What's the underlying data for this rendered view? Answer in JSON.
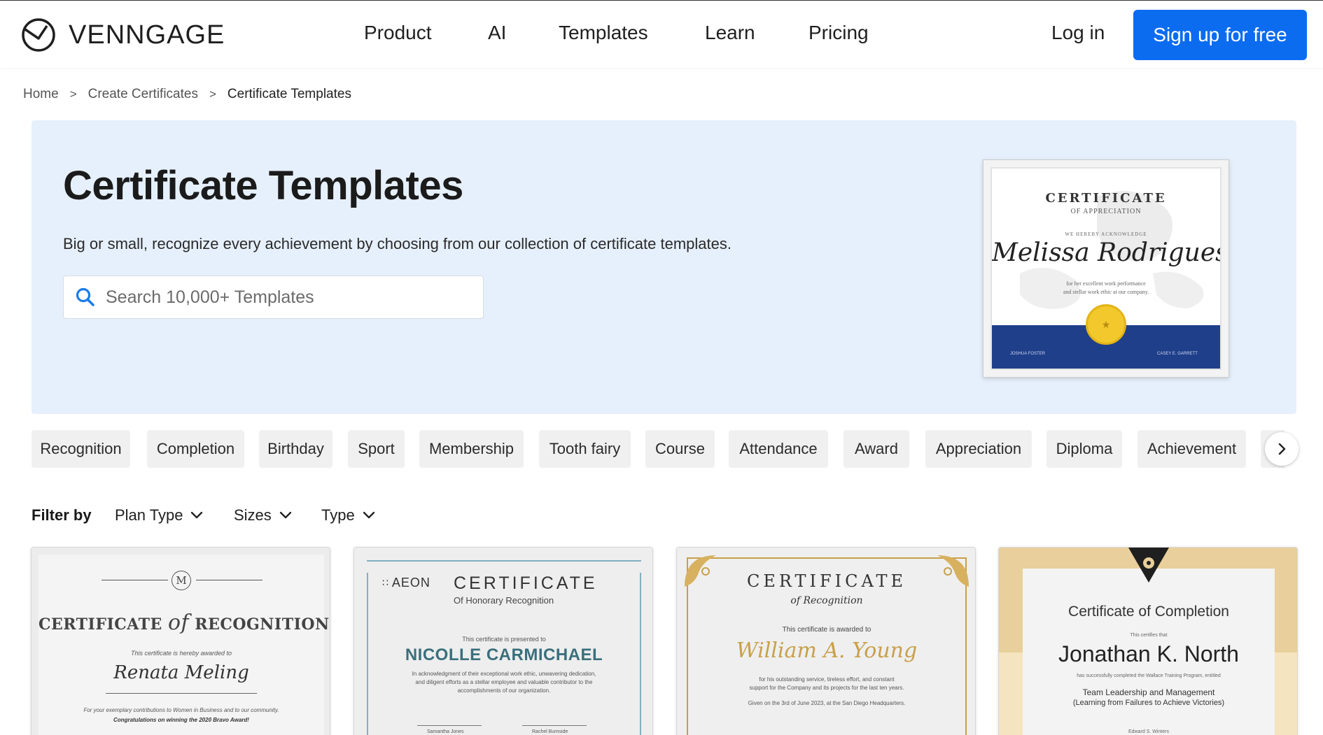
{
  "brand": {
    "name": "VENNGAGE"
  },
  "nav": {
    "product": "Product",
    "ai": "AI",
    "templates": "Templates",
    "learn": "Learn",
    "pricing": "Pricing",
    "login": "Log in",
    "signup": "Sign up for free"
  },
  "breadcrumb": {
    "home": "Home",
    "sep1": ">",
    "create": "Create Certificates",
    "sep2": ">",
    "current": "Certificate Templates"
  },
  "hero": {
    "title": "Certificate Templates",
    "subtitle": "Big or small, recognize every achievement by choosing from our collection of certificate templates.",
    "search_placeholder": "Search 10,000+ Templates",
    "preview": {
      "heading": "CERTIFICATE",
      "subheading": "OF APPRECIATION",
      "acknowledge": "WE HEREBY ACKNOWLEDGE",
      "name": "Melissa Rodrigues",
      "body_line1": "for her excellent work performance",
      "body_line2": "and stellar work ethic at our company.",
      "sign_left": "JOSHUA FOSTER",
      "sign_right": "CASEY E. GARRETT"
    }
  },
  "categories": [
    "Recognition",
    "Completion",
    "Birthday",
    "Sport",
    "Membership",
    "Tooth fairy",
    "Course",
    "Attendance",
    "Award",
    "Appreciation",
    "Diploma",
    "Achievement"
  ],
  "filter": {
    "label": "Filter by",
    "plan_type": "Plan Type",
    "sizes": "Sizes",
    "type": "Type"
  },
  "cards": {
    "c1": {
      "monogram": "M",
      "title_left": "CERTIFICATE",
      "title_of": "of",
      "title_right": "RECOGNITION",
      "awarded": "This certificate is hereby awarded to",
      "name": "Renata Meling",
      "line1": "For your exemplary contributions to Women in Business and to our community.",
      "line2": "Congratulations on winning the 2020 Bravo Award!"
    },
    "c2": {
      "brand": "AEON",
      "title": "CERTIFICATE",
      "subtitle": "Of Honorary Recognition",
      "presented": "This certificate is presented to",
      "name": "NICOLLE CARMICHAEL",
      "body1": "In acknowledgment of their exceptional work ethic, unwavering dedication,",
      "body2": "and diligent efforts as a stellar employee and valuable contributor to the",
      "body3": "accomplishments of our organization.",
      "sign_left": "Samantha Jones",
      "sign_right": "Rachel Burnside"
    },
    "c3": {
      "title": "CERTIFICATE",
      "subtitle": "of Recognition",
      "awarded": "This certificate is awarded to",
      "name": "William A. Young",
      "body1": "for his outstanding service, tireless effort, and constant",
      "body2": "support for the Company and its projects for the last ten years.",
      "body3": "Given on the 3rd of June 2023, at the San Diego Headquarters."
    },
    "c4": {
      "title": "Certificate of Completion",
      "certifies": "This certifies that",
      "name": "Jonathan K. North",
      "completed": "has successfully completed the Wallace Training Program, entitled",
      "program1": "Team Leadership and Management",
      "program2": "(Learning from Failures to Achieve Victories)",
      "sign": "Edward S. Winters"
    }
  },
  "colors": {
    "accent": "#0b6cf0",
    "hero_bg": "#e6f0fc",
    "chip_bg": "#f0f0f0",
    "cert_blue": "#1f3f8a",
    "cert_gold": "#c8a04a",
    "teal": "#3a6f7c"
  }
}
